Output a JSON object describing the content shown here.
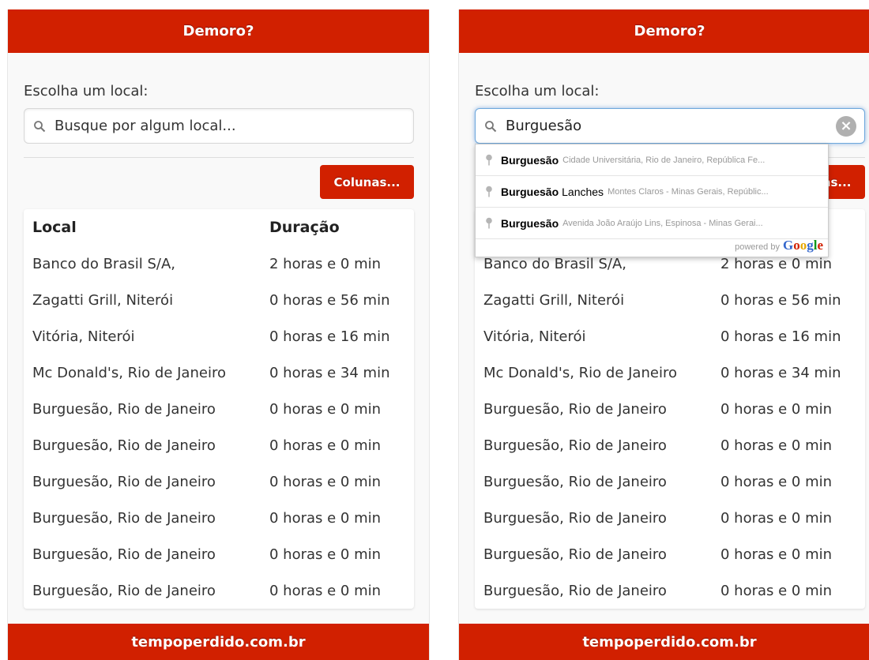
{
  "colors": {
    "brand_red": "#d12000",
    "text": "#333333"
  },
  "app": {
    "title": "Demoro?",
    "footer": "tempoperdido.com.br"
  },
  "search": {
    "label": "Escolha um local:",
    "placeholder": "Busque por algum local...",
    "value": "Burguesão"
  },
  "columns_button": "Colunas...",
  "table": {
    "headers": {
      "local": "Local",
      "duration": "Duração"
    },
    "rows": [
      {
        "local": "Banco do Brasil S/A,",
        "duration": "2 horas e 0 min"
      },
      {
        "local": "Zagatti Grill, Niterói",
        "duration": "0 horas e 56 min"
      },
      {
        "local": "Vitória, Niterói",
        "duration": "0 horas e 16 min"
      },
      {
        "local": "Mc Donald's, Rio de Janeiro",
        "duration": "0 horas e 34 min"
      },
      {
        "local": "Burguesão, Rio de Janeiro",
        "duration": "0 horas e 0 min"
      },
      {
        "local": "Burguesão, Rio de Janeiro",
        "duration": "0 horas e 0 min"
      },
      {
        "local": "Burguesão, Rio de Janeiro",
        "duration": "0 horas e 0 min"
      },
      {
        "local": "Burguesão, Rio de Janeiro",
        "duration": "0 horas e 0 min"
      },
      {
        "local": "Burguesão, Rio de Janeiro",
        "duration": "0 horas e 0 min"
      },
      {
        "local": "Burguesão, Rio de Janeiro",
        "duration": "0 horas e 0 min"
      }
    ]
  },
  "autocomplete": {
    "suggestions": [
      {
        "match": "Burguesão",
        "rest": "",
        "detail": "Cidade Universitária, Rio de Janeiro, República Fe..."
      },
      {
        "match": "Burguesão",
        "rest": "Lanches",
        "detail": "Montes Claros - Minas Gerais, Repúblic..."
      },
      {
        "match": "Burguesão",
        "rest": "",
        "detail": "Avenida João Araújo Lins, Espinosa - Minas Gerai..."
      }
    ],
    "powered_by": "powered by",
    "brand": "Google"
  },
  "icons": {
    "search": "search-icon",
    "clear": "clear-icon",
    "pin": "map-pin-icon"
  }
}
